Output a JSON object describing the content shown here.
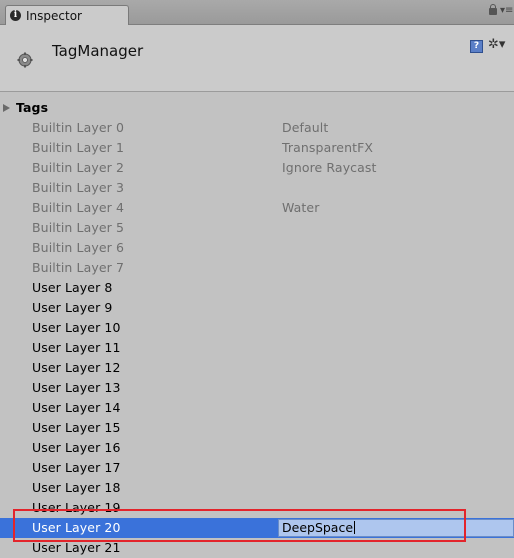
{
  "tab": {
    "title": "Inspector"
  },
  "header": {
    "object_name": "TagManager"
  },
  "tags_label": "Tags",
  "layers": [
    {
      "label": "Builtin Layer 0",
      "value": "Default",
      "builtin": true
    },
    {
      "label": "Builtin Layer 1",
      "value": "TransparentFX",
      "builtin": true
    },
    {
      "label": "Builtin Layer 2",
      "value": "Ignore Raycast",
      "builtin": true
    },
    {
      "label": "Builtin Layer 3",
      "value": "",
      "builtin": true
    },
    {
      "label": "Builtin Layer 4",
      "value": "Water",
      "builtin": true
    },
    {
      "label": "Builtin Layer 5",
      "value": "",
      "builtin": true
    },
    {
      "label": "Builtin Layer 6",
      "value": "",
      "builtin": true
    },
    {
      "label": "Builtin Layer 7",
      "value": "",
      "builtin": true
    },
    {
      "label": "User Layer 8",
      "value": ""
    },
    {
      "label": "User Layer 9",
      "value": ""
    },
    {
      "label": "User Layer 10",
      "value": ""
    },
    {
      "label": "User Layer 11",
      "value": ""
    },
    {
      "label": "User Layer 12",
      "value": ""
    },
    {
      "label": "User Layer 13",
      "value": ""
    },
    {
      "label": "User Layer 14",
      "value": ""
    },
    {
      "label": "User Layer 15",
      "value": ""
    },
    {
      "label": "User Layer 16",
      "value": ""
    },
    {
      "label": "User Layer 17",
      "value": ""
    },
    {
      "label": "User Layer 18",
      "value": ""
    },
    {
      "label": "User Layer 19",
      "value": ""
    },
    {
      "label": "User Layer 20",
      "value": "DeepSpace",
      "selected": true
    },
    {
      "label": "User Layer 21",
      "value": ""
    }
  ]
}
